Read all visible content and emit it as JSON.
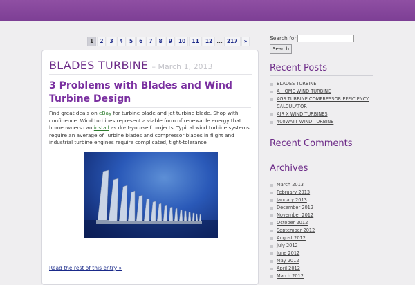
{
  "pagination": {
    "pages": [
      "1",
      "2",
      "3",
      "4",
      "5",
      "6",
      "7",
      "8",
      "9",
      "10",
      "11",
      "12",
      "...",
      "217",
      "»"
    ],
    "current": "1"
  },
  "post": {
    "blog_title": "BLADES TURBINE",
    "date": "– March 1, 2013",
    "title": "3 Problems with Blades and Wind Turbine Design",
    "body_before_link1": "Find great deals on ",
    "link1": "eBay",
    "body_after_link1": " for turbine blade and jet turbine blade. Shop with confidence. Wind turbines represent a viable form of renewable energy that homeowners can ",
    "link2": "install",
    "body_after_link2": " as do-it-yourself projects. Typical wind turbine systems require an average of Turbine blades and compressor blades in flight and industrial turbine engines require complicated, tight-tolerance",
    "read_more": "Read the rest of this entry »"
  },
  "search": {
    "label": "Search for:",
    "value": "",
    "button": "Search"
  },
  "recent_posts": {
    "heading": "Recent Posts",
    "items": [
      "BLADES TURBINE",
      "A HOME WIND TURBINE",
      "AGS TURBINE COMPRESSOR EFFICIENCY CALCULATOR",
      "AIR X WIND TURBINES",
      "400WATT WIND TURBINE"
    ]
  },
  "recent_comments": {
    "heading": "Recent Comments"
  },
  "archives": {
    "heading": "Archives",
    "items": [
      "March 2013",
      "February 2013",
      "January 2013",
      "December 2012",
      "November 2012",
      "October 2012",
      "September 2012",
      "August 2012",
      "July 2012",
      "June 2012",
      "May 2012",
      "April 2012",
      "March 2012"
    ]
  },
  "colors": {
    "header": "#8f4fa3",
    "accent": "#6d2b88",
    "link": "#1a2a8a"
  }
}
